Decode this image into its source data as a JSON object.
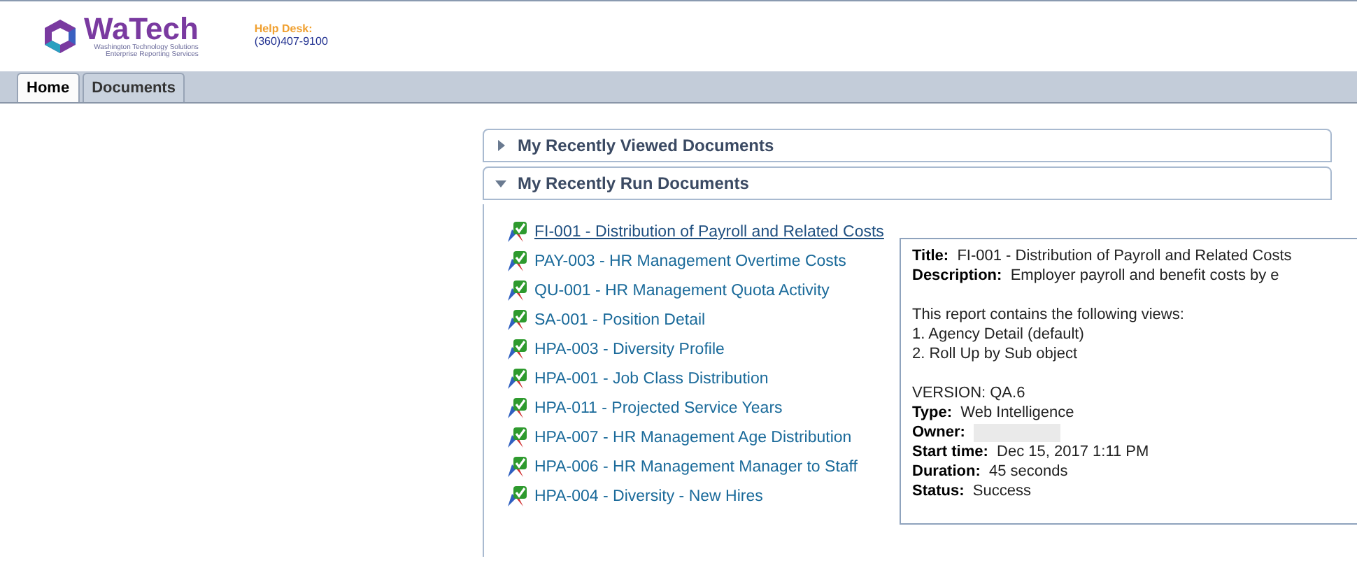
{
  "header": {
    "logo": "WaTech",
    "logo_subtitle": [
      "Washington Technology Solutions",
      "Enterprise Reporting Services"
    ],
    "help_desk_label": "Help Desk:",
    "help_desk_phone": "(360)407-9100"
  },
  "tabs": [
    {
      "label": "Home",
      "selected": true
    },
    {
      "label": "Documents",
      "selected": false
    }
  ],
  "panels": [
    {
      "title": "My Recently Viewed Documents",
      "expanded": false
    },
    {
      "title": "My Recently Run Documents",
      "expanded": true
    }
  ],
  "documents": [
    {
      "label": "FI-001 - Distribution of Payroll and Related Costs",
      "hovered": true
    },
    {
      "label": "PAY-003 - HR Management Overtime Costs",
      "hovered": false
    },
    {
      "label": "QU-001 - HR Management Quota Activity",
      "hovered": false
    },
    {
      "label": "SA-001 - Position Detail",
      "hovered": false
    },
    {
      "label": "HPA-003 - Diversity Profile",
      "hovered": false
    },
    {
      "label": "HPA-001 - Job Class Distribution",
      "hovered": false
    },
    {
      "label": "HPA-011 - Projected Service Years",
      "hovered": false
    },
    {
      "label": "HPA-007 - HR Management Age Distribution",
      "hovered": false
    },
    {
      "label": "HPA-006 - HR Management Manager to Staff",
      "hovered": false
    },
    {
      "label": "HPA-004 - Diversity - New Hires",
      "hovered": false
    }
  ],
  "tooltip": {
    "title_label": "Title:",
    "title": "FI-001 - Distribution of Payroll and Related Costs",
    "description_label": "Description:",
    "description": "Employer payroll and benefit costs by e",
    "body": [
      "This report contains the following views:",
      "1. Agency Detail (default)",
      "2. Roll Up by Sub object"
    ],
    "version": "VERSION: QA.6",
    "fields": [
      {
        "label": "Type:",
        "value": "Web Intelligence",
        "kind": "text"
      },
      {
        "label": "Owner:",
        "kind": "redacted"
      },
      {
        "label": "Start time:",
        "value": "Dec 15, 2017 1:11 PM",
        "kind": "text"
      },
      {
        "label": "Duration:",
        "value": "45 seconds",
        "kind": "text"
      },
      {
        "label": "Status:",
        "value": "Success",
        "kind": "text"
      }
    ]
  }
}
